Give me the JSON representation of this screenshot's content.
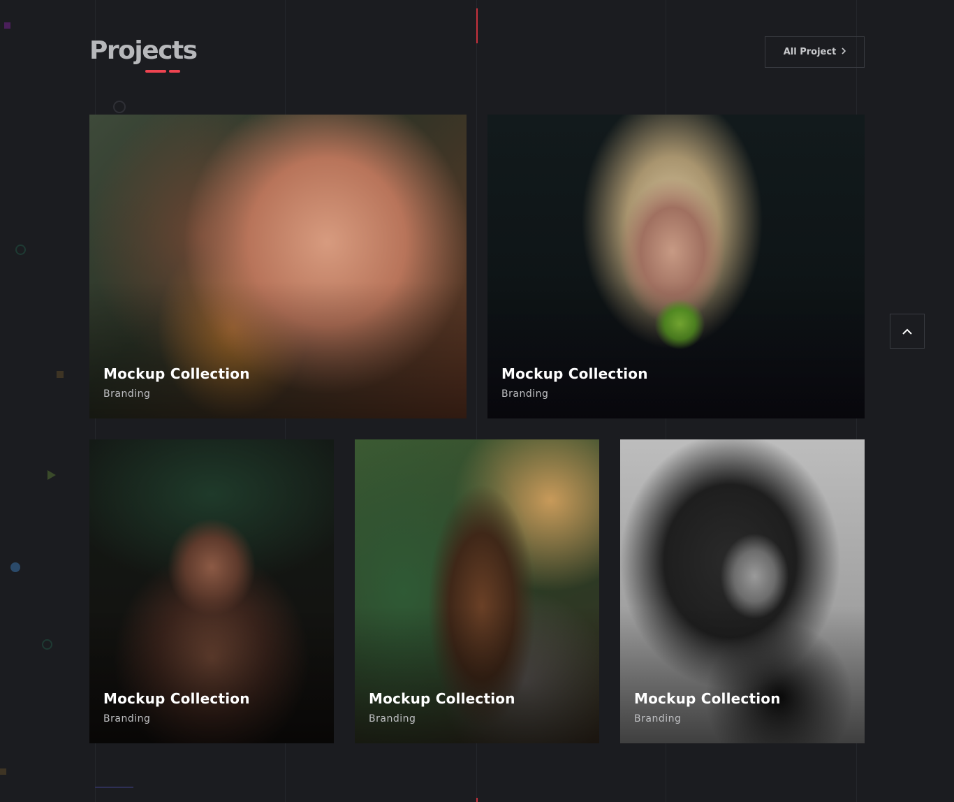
{
  "section": {
    "title": "Projects",
    "all_project_label": "All Project"
  },
  "projects": [
    {
      "title": "Mockup Collection",
      "category": "Branding"
    },
    {
      "title": "Mockup Collection",
      "category": "Branding"
    },
    {
      "title": "Mockup Collection",
      "category": "Branding"
    },
    {
      "title": "Mockup Collection",
      "category": "Branding"
    },
    {
      "title": "Mockup Collection",
      "category": "Branding"
    }
  ],
  "colors": {
    "background": "#1b1c20",
    "accent": "#ef4451",
    "title": "#b7b8bb"
  },
  "icons": {
    "all_project": "chevron-right-icon",
    "scroll_top": "chevron-up-icon"
  }
}
